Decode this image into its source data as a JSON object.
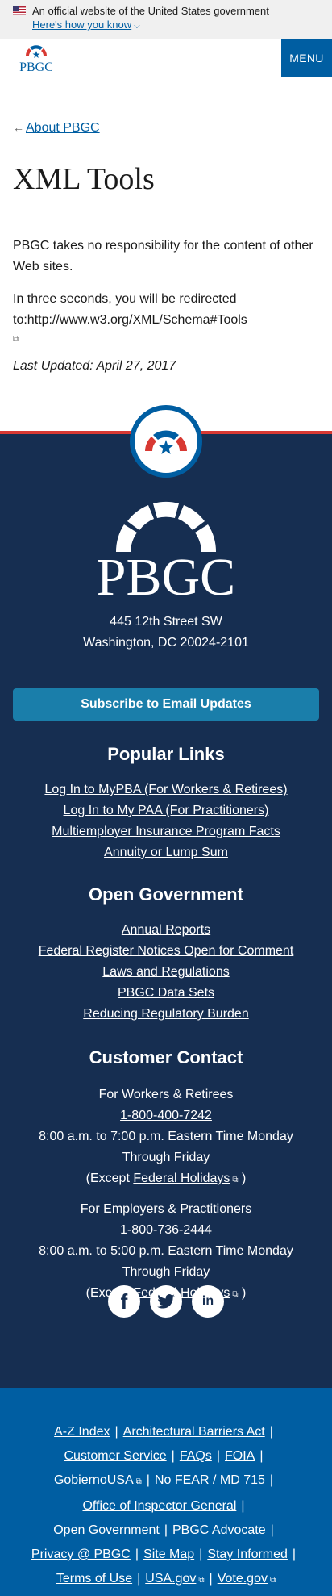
{
  "gov_banner": {
    "text": "An official website of the United States government",
    "link": "Here's how you know"
  },
  "header": {
    "logo_text": "PBGC",
    "menu_label": "MENU"
  },
  "main": {
    "back_link": "About PBGC",
    "title": "XML Tools",
    "paragraph1": "PBGC takes no responsibility for the content of other Web sites.",
    "paragraph2": "In three seconds, you will be redirected to:http://www.w3.org/XML/Schema#Tools",
    "updated": "Last Updated: April 27, 2017"
  },
  "footer": {
    "logo_text": "PBGC",
    "address_line1": "445 12th Street SW",
    "address_line2": "Washington, DC 20024-2101",
    "subscribe_label": "Subscribe to Email Updates",
    "popular_heading": "Popular Links",
    "popular_links": [
      "Log In to MyPBA (For Workers & Retirees)",
      "Log In to My PAA (For Practitioners)",
      "Multiemployer Insurance Program Facts",
      "Annuity or Lump Sum"
    ],
    "opengov_heading": "Open Government",
    "opengov_links": [
      "Annual Reports",
      "Federal Register Notices Open for Comment",
      "Laws and Regulations",
      "PBGC Data Sets",
      "Reducing Regulatory Burden"
    ],
    "contact_heading": "Customer Contact",
    "workers": {
      "label": "For Workers & Retirees",
      "phone": "1-800-400-7242",
      "hours": "8:00 a.m. to 7:00 p.m. Eastern Time Monday Through Friday",
      "except_prefix": "(Except",
      "holidays": "Federal Holidays",
      "except_suffix": ")"
    },
    "employers": {
      "label": "For Employers & Practitioners",
      "phone": "1-800-736-2444",
      "hours": "8:00 a.m. to 5:00 p.m. Eastern Time Monday Through Friday",
      "except_prefix": "(Except",
      "holidays": "Federal Holidays",
      "except_suffix": ")"
    },
    "social": {
      "facebook": "f",
      "linkedin": "in"
    }
  },
  "bottom_links": {
    "az": "A-Z Index",
    "barriers": "Architectural Barriers Act",
    "customer_service": "Customer Service",
    "faqs": "FAQs",
    "foia": "FOIA",
    "gobierno": "GobiernoUSA",
    "nofear": "No FEAR / MD 715",
    "oig": "Office of Inspector General",
    "opengov": "Open Government",
    "advocate": "PBGC Advocate",
    "privacy": "Privacy @ PBGC",
    "sitemap": "Site Map",
    "informed": "Stay Informed",
    "terms": "Terms of Use",
    "usagov": "USA.gov",
    "votegov": "Vote.gov"
  },
  "colors": {
    "primary": "#005ea2",
    "footer_bg": "#162e51",
    "accent_red": "#d83933",
    "subscribe_bg": "#1a7eaa"
  }
}
